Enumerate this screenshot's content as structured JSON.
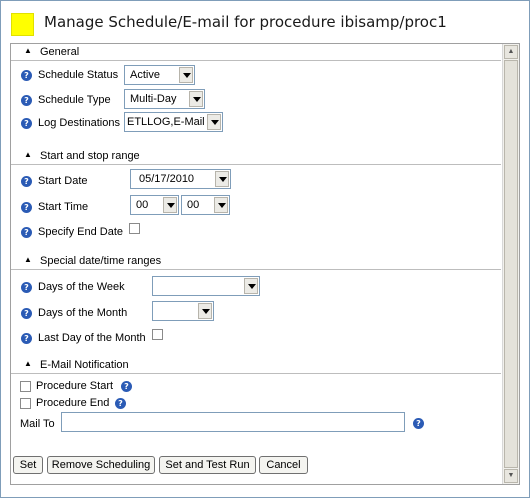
{
  "title": "Manage Schedule/E-mail for procedure ibisamp/proc1",
  "sections": {
    "general": "General",
    "start_stop": "Start and stop range",
    "special": "Special date/time ranges",
    "email": "E-Mail Notification"
  },
  "general": {
    "schedule_status_label": "Schedule Status",
    "schedule_status_value": "Active",
    "schedule_type_label": "Schedule Type",
    "schedule_type_value": "Multi-Day",
    "log_destinations_label": "Log Destinations",
    "log_destinations_value": "ETLLOG,E-Mail"
  },
  "start_stop": {
    "start_date_label": "Start Date",
    "start_date_value": "05/17/2010",
    "start_time_label": "Start Time",
    "start_hour": "00",
    "start_minute": "00",
    "specify_end_date_label": "Specify End Date"
  },
  "special": {
    "days_of_week_label": "Days of the Week",
    "days_of_month_label": "Days of the Month",
    "last_day_label": "Last Day of the Month"
  },
  "email": {
    "procedure_start_label": "Procedure Start",
    "procedure_end_label": "Procedure End",
    "mail_to_label": "Mail To",
    "mail_to_value": ""
  },
  "buttons": {
    "set": "Set",
    "remove_scheduling": "Remove Scheduling",
    "set_and_test_run": "Set and Test Run",
    "cancel": "Cancel"
  },
  "colors": {
    "title_square": "#ffff00",
    "help_icon": "#2b5bb5"
  }
}
